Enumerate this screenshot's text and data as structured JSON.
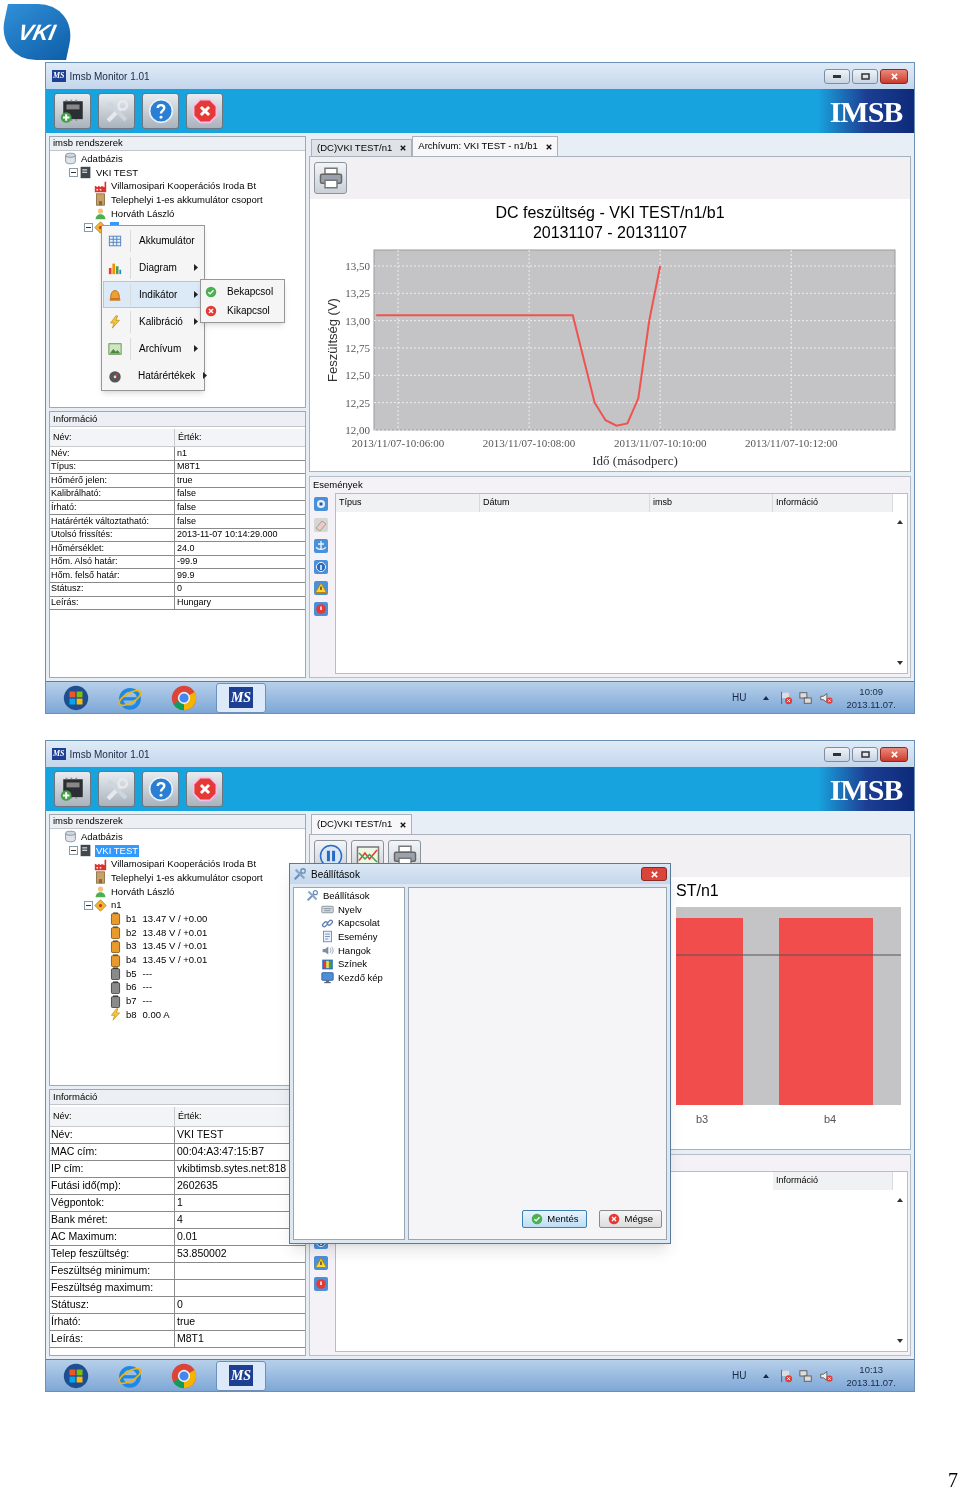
{
  "logo": {
    "text": "VKI"
  },
  "screenshots": [
    {
      "window": {
        "title": "Imsb Monitor 1.01",
        "app_icon": "MS",
        "brand": "IMSB"
      },
      "toolbar": [
        {
          "kind": "chip"
        },
        {
          "kind": "tools"
        },
        {
          "kind": "help"
        },
        {
          "kind": "quit"
        }
      ],
      "tree": {
        "header": "imsb rendszerek",
        "items": [
          {
            "label": "Adatbázis",
            "kind": "database",
            "selected": false,
            "children": [
              {
                "label": "VKI TEST",
                "kind": "device",
                "selected": false,
                "expanded": true,
                "children": [
                  {
                    "label": "Villamosipari Kooperációs Iroda Bt",
                    "kind": "company",
                    "selected": false
                  },
                  {
                    "label": "Telephelyi 1-es akkumulátor csoport",
                    "kind": "site",
                    "selected": false
                  },
                  {
                    "label": "Horváth László",
                    "kind": "person",
                    "selected": false
                  },
                  {
                    "kind": "node",
                    "selected": true,
                    "expanded": true
                  }
                ]
              }
            ]
          }
        ]
      },
      "context_menu": {
        "items": [
          {
            "label": "Akkumulátor",
            "kind": "table",
            "submenu": false,
            "selected": false
          },
          {
            "label": "Diagram",
            "kind": "chart",
            "submenu": true,
            "selected": false
          },
          {
            "label": "Indikátor",
            "kind": "bell",
            "submenu": true,
            "selected": true
          },
          {
            "label": "Kalibráció",
            "kind": "bolt",
            "submenu": true,
            "selected": false
          },
          {
            "label": "Archívum",
            "kind": "archive",
            "submenu": true,
            "selected": false
          },
          {
            "label": "Határértékek",
            "kind": "limit",
            "submenu": true,
            "selected": false
          }
        ],
        "submenu": [
          {
            "label": "Bekapcsol",
            "kind": "on"
          },
          {
            "label": "Kikapcsol",
            "kind": "off"
          }
        ]
      },
      "info": {
        "header": "Információ",
        "columns": [
          "Név:",
          "Érték:"
        ],
        "rows": [
          {
            "name": "Név:",
            "value": "n1"
          },
          {
            "name": "Típus:",
            "value": "M8T1"
          },
          {
            "name": "Hőmérő jelen:",
            "value": "true"
          },
          {
            "name": "Kalibrálható:",
            "value": "false"
          },
          {
            "name": "Írható:",
            "value": "false"
          },
          {
            "name": "Határérték változtatható:",
            "value": "false"
          },
          {
            "name": "Utolsó frissítés:",
            "value": "2013-11-07 10:14:29.000"
          },
          {
            "name": "Hőmérséklet:",
            "value": "24.0"
          },
          {
            "name": "Hőm. Alsó határ:",
            "value": "-99.9"
          },
          {
            "name": "Hőm. felső határ:",
            "value": "99.9"
          },
          {
            "name": "Státusz:",
            "value": "0"
          },
          {
            "name": "Leírás:",
            "value": "Hungary"
          }
        ]
      },
      "tabs": [
        {
          "label": "(DC)VKI TEST/n1",
          "selected": false
        },
        {
          "label": "Archívum: VKI TEST - n1/b1",
          "selected": true
        }
      ],
      "content_toolbar": [
        {
          "kind": "print"
        }
      ],
      "chart": {
        "kind": "line",
        "chart_data": {
          "type": "line",
          "title": "DC feszültség - VKI TEST/n1/b1",
          "subtitle": "20131107 - 20131107",
          "xlabel": "Idő (másodperc)",
          "ylabel": "Feszültség (V)",
          "categories": [
            null,
            null,
            "2013/11/07-10:06:00",
            null,
            null,
            null,
            null,
            null,
            null,
            null,
            null,
            null,
            null,
            null,
            "2013/11/07-10:08:00",
            null,
            null,
            null,
            null,
            null,
            null,
            null,
            null,
            null,
            null,
            null,
            "2013/11/07-10:10:00",
            null,
            null,
            null,
            null,
            null,
            null,
            null,
            null,
            null,
            null,
            null,
            "2013/11/07-10:12:00",
            null,
            null,
            null,
            null,
            null,
            null,
            null,
            null,
            null
          ],
          "series": [
            {
              "color": "#ef5350",
              "values": [
                13.05,
                13.05,
                13.05,
                13.05,
                13.05,
                13.05,
                13.05,
                13.05,
                13.05,
                13.05,
                13.05,
                13.05,
                13.05,
                13.05,
                13.05,
                13.05,
                13.05,
                13.05,
                13.05,
                12.65,
                12.25,
                12.09,
                12.04,
                12.06,
                12.29,
                13.0,
                13.5,
                null,
                null,
                null,
                null,
                null,
                null,
                null,
                null,
                null,
                null,
                null,
                null,
                null,
                null,
                null,
                null,
                null,
                null,
                null,
                null,
                null
              ]
            }
          ],
          "grid": true,
          "ylim": [
            12,
            13.646
          ],
          "yticks": [
            {
              "value": 12,
              "label": "12,00"
            },
            {
              "value": 12.25,
              "label": "12,25"
            },
            {
              "value": 12.5,
              "label": "12,50"
            },
            {
              "value": 12.75,
              "label": "12,75"
            },
            {
              "value": 13,
              "label": "13,00"
            },
            {
              "value": 13.25,
              "label": "13,25"
            },
            {
              "value": 13.5,
              "label": "13,50"
            }
          ]
        }
      },
      "events": {
        "header": "Események",
        "columns": [
          "Típus",
          "Dátum",
          "imsb",
          "Információ"
        ],
        "buttons": [
          {
            "kind": "stop"
          },
          {
            "kind": "eraser"
          },
          {
            "kind": "anchor"
          },
          {
            "kind": "info"
          },
          {
            "kind": "warning"
          },
          {
            "kind": "error"
          }
        ]
      },
      "taskbar": {
        "apps": [
          {
            "kind": "start",
            "selected": false
          },
          {
            "kind": "ie",
            "selected": false
          },
          {
            "kind": "chrome",
            "selected": false
          },
          {
            "kind": "app",
            "label": "MS",
            "selected": true
          }
        ],
        "language": "HU",
        "tray": [
          {
            "kind": "flag"
          },
          {
            "kind": "network"
          },
          {
            "kind": "speaker"
          }
        ],
        "time": "10:09",
        "date": "2013.11.07."
      }
    },
    {
      "window": {
        "title": "Imsb Monitor 1.01",
        "app_icon": "MS",
        "brand": "IMSB"
      },
      "toolbar": [
        {
          "kind": "chip"
        },
        {
          "kind": "tools"
        },
        {
          "kind": "help"
        },
        {
          "kind": "quit"
        }
      ],
      "tree": {
        "header": "imsb rendszerek",
        "items": [
          {
            "label": "Adatbázis",
            "kind": "database",
            "selected": false,
            "children": [
              {
                "label": "VKI TEST",
                "kind": "device",
                "selected": true,
                "expanded": true,
                "children": [
                  {
                    "label": "Villamosipari Kooperációs Iroda Bt",
                    "kind": "company",
                    "selected": false
                  },
                  {
                    "label": "Telephelyi 1-es akkumulátor csoport",
                    "kind": "site",
                    "selected": false
                  },
                  {
                    "label": "Horváth László",
                    "kind": "person",
                    "selected": false
                  },
                  {
                    "label": "n1",
                    "kind": "node",
                    "selected": false,
                    "expanded": true,
                    "children": [
                      {
                        "label": "b1",
                        "reading": "13.47 V / +0.00",
                        "kind": "battery",
                        "selected": false
                      },
                      {
                        "label": "b2",
                        "reading": "13.48 V / +0.01",
                        "kind": "battery",
                        "selected": false
                      },
                      {
                        "label": "b3",
                        "reading": "13.45 V / +0.01",
                        "kind": "battery",
                        "selected": false
                      },
                      {
                        "label": "b4",
                        "reading": "13.45 V / +0.01",
                        "kind": "battery",
                        "selected": false
                      },
                      {
                        "label": "b5",
                        "reading": "---",
                        "kind": "idle",
                        "selected": false
                      },
                      {
                        "label": "b6",
                        "reading": "---",
                        "kind": "idle",
                        "selected": false
                      },
                      {
                        "label": "b7",
                        "reading": "---",
                        "kind": "idle",
                        "selected": false
                      },
                      {
                        "label": "b8",
                        "reading": "0.00 A",
                        "kind": "current",
                        "selected": false
                      }
                    ]
                  }
                ]
              }
            ]
          }
        ]
      },
      "info": {
        "header": "Információ",
        "columns": [
          "Név:",
          "Érték:"
        ],
        "rows": [
          {
            "name": "Név:",
            "value": "VKI TEST"
          },
          {
            "name": "MAC cím:",
            "value": "00:04:A3:47:15:B7"
          },
          {
            "name": "IP cím:",
            "value": "vkibtimsb.sytes.net:818"
          },
          {
            "name": "Futási idő(mp):",
            "value": "2602635"
          },
          {
            "name": "Végpontok:",
            "value": "1"
          },
          {
            "name": "Bank méret:",
            "value": "4"
          },
          {
            "name": "AC Maximum:",
            "value": "0.01"
          },
          {
            "name": "Telep feszültség:",
            "value": "53.850002"
          },
          {
            "name": "Feszültség minimum:"
          },
          {
            "name": "Feszültség maximum:"
          },
          {
            "name": "Státusz:",
            "value": "0"
          },
          {
            "name": "Írható:",
            "value": "true"
          },
          {
            "name": "Leírás:",
            "value": "M8T1"
          }
        ]
      },
      "tabs": [
        {
          "label": "(DC)VKI TEST/n1",
          "selected": true
        }
      ],
      "content_toolbar": [
        {
          "kind": "pause"
        },
        {
          "kind": "linechart"
        },
        {
          "kind": "print"
        }
      ],
      "chart": {
        "kind": "bars",
        "title": "ST/n1",
        "labels": [
          "b3",
          "b4"
        ]
      },
      "events": {
        "columns": [
          "Információ"
        ],
        "buttons": [
          {
            "kind": "info"
          },
          {
            "kind": "warning"
          },
          {
            "kind": "error"
          }
        ]
      },
      "dialog": {
        "title": "Beállítások",
        "tree": [
          {
            "label": "Beállítások",
            "kind": "settings",
            "selected": false,
            "children": [
              {
                "label": "Nyelv",
                "kind": "language",
                "selected": false
              },
              {
                "label": "Kapcsolat",
                "kind": "connection",
                "selected": false
              },
              {
                "label": "Esemény",
                "kind": "event",
                "selected": false
              },
              {
                "label": "Hangok",
                "kind": "sound",
                "selected": false
              },
              {
                "label": "Színek",
                "kind": "color",
                "selected": false
              },
              {
                "label": "Kezdő kép",
                "kind": "screen",
                "selected": false
              }
            ]
          }
        ],
        "buttons": [
          {
            "label": "Mentés",
            "kind": "save"
          },
          {
            "label": "Mégse",
            "kind": "cancel"
          }
        ]
      },
      "taskbar": {
        "apps": [
          {
            "kind": "start",
            "selected": false
          },
          {
            "kind": "ie",
            "selected": false
          },
          {
            "kind": "chrome",
            "selected": false
          },
          {
            "kind": "app",
            "label": "MS",
            "selected": true
          }
        ],
        "language": "HU",
        "tray": [
          {
            "kind": "flag"
          },
          {
            "kind": "network"
          },
          {
            "kind": "speaker"
          }
        ],
        "time": "10:13",
        "date": "2013.11.07."
      }
    }
  ],
  "page_number": "7"
}
